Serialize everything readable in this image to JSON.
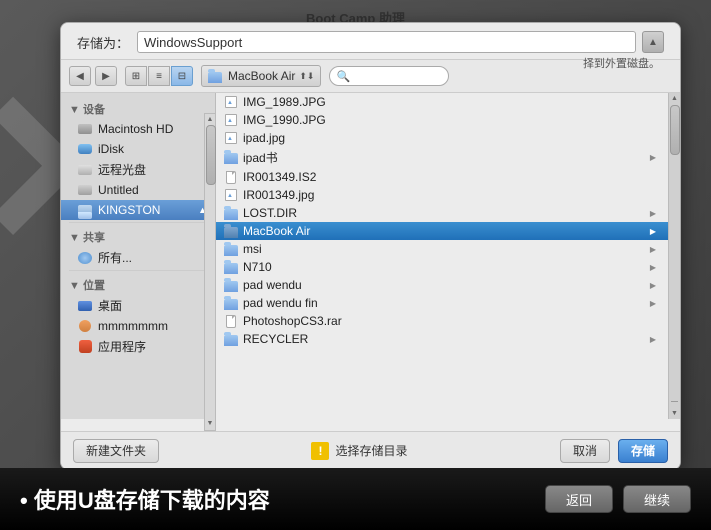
{
  "window": {
    "title": "Boot Camp 助理",
    "hint": "择到外置磁盘。"
  },
  "save_as": {
    "label": "存储为：",
    "value": "WindowsSupport",
    "expand_icon": "▲"
  },
  "toolbar": {
    "back_icon": "◀",
    "forward_icon": "▶",
    "view_icons": [
      "⊞",
      "≡",
      "⊟"
    ],
    "location_label": "MacBook Air",
    "search_placeholder": ""
  },
  "sidebar": {
    "section_devices": "▼ 设备",
    "items_devices": [
      {
        "id": "macintosh-hd",
        "label": "Macintosh HD",
        "icon": "💿"
      },
      {
        "id": "idisk",
        "label": "iDisk",
        "icon": "☁"
      },
      {
        "id": "remote-disk",
        "label": "远程光盘",
        "icon": "💿"
      },
      {
        "id": "untitled",
        "label": "Untitled",
        "icon": "💽"
      },
      {
        "id": "kingston",
        "label": "KINGSTON",
        "icon": "📁",
        "selected": true
      }
    ],
    "section_shared": "▼ 共享",
    "items_shared": [
      {
        "id": "all",
        "label": "所有...",
        "icon": "🌐"
      }
    ],
    "section_places": "▼ 位置",
    "items_places": [
      {
        "id": "desktop",
        "label": "桌面",
        "icon": "🖥"
      },
      {
        "id": "mmmmmmm",
        "label": "mmmmmmm",
        "icon": "👤"
      },
      {
        "id": "apps",
        "label": "应用程序",
        "icon": "🚀"
      }
    ]
  },
  "files": [
    {
      "name": "IMG_1989.JPG",
      "type": "image"
    },
    {
      "name": "IMG_1990.JPG",
      "type": "image"
    },
    {
      "name": "ipad.jpg",
      "type": "image"
    },
    {
      "name": "ipad书",
      "type": "folder"
    },
    {
      "name": "IR001349.IS2",
      "type": "file"
    },
    {
      "name": "IR001349.jpg",
      "type": "image"
    },
    {
      "name": "LOST.DIR",
      "type": "folder"
    },
    {
      "name": "MacBook Air",
      "type": "folder_dark",
      "highlighted": true,
      "has_arrow": true
    },
    {
      "name": "msi",
      "type": "folder",
      "has_arrow": true
    },
    {
      "name": "N710",
      "type": "folder",
      "has_arrow": true
    },
    {
      "name": "pad wendu",
      "type": "folder",
      "has_arrow": true
    },
    {
      "name": "pad wendu fin",
      "type": "folder",
      "has_arrow": true
    },
    {
      "name": "PhotoshopCS3.rar",
      "type": "file"
    },
    {
      "name": "RECYCLER",
      "type": "folder",
      "has_arrow": true
    }
  ],
  "bottom_buttons": {
    "new_folder": "新建文件夹",
    "cancel": "取消",
    "save": "存储",
    "warning_icon": "!",
    "warning_text": "选择存储目录"
  },
  "bottom_bar": {
    "instruction": "• 使用U盘存储下载的内容",
    "back_btn": "返回",
    "continue_btn": "继续"
  }
}
